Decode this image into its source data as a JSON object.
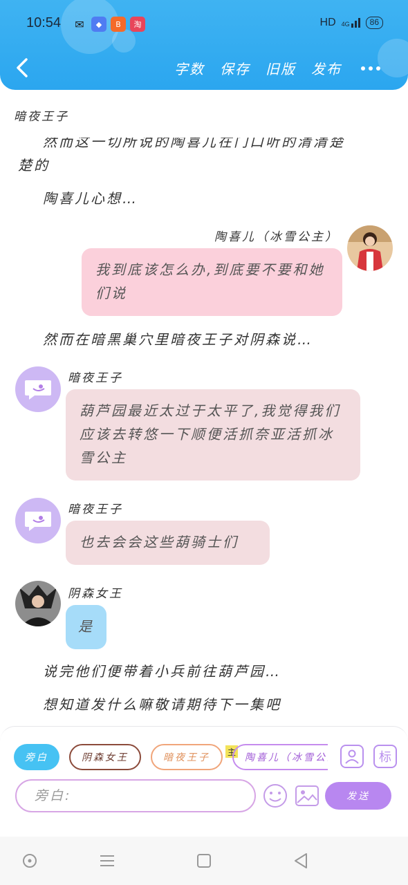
{
  "status_bar": {
    "time": "10:54",
    "network": "HD",
    "signal": "4G",
    "battery": "86",
    "apps": [
      {
        "icon": "wechat-icon",
        "color": "#1a1a1a",
        "glyph": "✉"
      },
      {
        "icon": "app-diamond-icon",
        "color": "#4f7cf2",
        "glyph": "◆"
      },
      {
        "icon": "app-orange-icon",
        "color": "#f56a2a",
        "glyph": "B"
      },
      {
        "icon": "app-red-icon",
        "color": "#e8455a",
        "glyph": "淘"
      }
    ]
  },
  "header": {
    "back_icon": "chevron-left-icon",
    "actions": [
      "字数",
      "保存",
      "旧版",
      "发布"
    ],
    "more_icon": "more-dots-icon"
  },
  "story": {
    "top_speaker": "暗夜王子",
    "narration_1_partial": "然而这一切所说的陶喜儿在门口听的清清楚",
    "narration_1_end": "楚的",
    "narration_2": "陶喜儿心想…",
    "msg_taoxier": {
      "speaker": "陶喜儿（冰雪公主）",
      "text": "我到底该怎么办,到底要不要和她们说"
    },
    "narration_3": "然而在暗黑巢穴里暗夜王子对阴森说…",
    "msg_prince_1": {
      "speaker": "暗夜王子",
      "text": "葫芦园最近太过于太平了,我觉得我们应该去转悠一下顺便活抓奈亚活抓冰雪公主"
    },
    "msg_prince_2": {
      "speaker": "暗夜王子",
      "text": "也去会会这些葫骑士们"
    },
    "msg_queen": {
      "speaker": "阴森女王",
      "text": "是"
    },
    "narration_4": "说完他们便带着小兵前往葫芦园…",
    "narration_5": "想知道发什么嘛敬请期待下一集吧"
  },
  "composer": {
    "chips": [
      "旁白",
      "阴森女王",
      "暗夜王子",
      "陶喜儿（冰雪公主）"
    ],
    "main_badge": "主",
    "person_icon": "person-icon",
    "tag_label": "标",
    "input_placeholder": "旁白:",
    "emoji_icon": "emoji-icon",
    "image_icon": "image-icon",
    "send_label": "发送"
  },
  "colors": {
    "header": "#2ba6ef",
    "pink_bubble": "#fbd0db",
    "rose_bubble": "#f3dde0",
    "blue_bubble": "#a6dcf9",
    "send": "#b887f0"
  }
}
